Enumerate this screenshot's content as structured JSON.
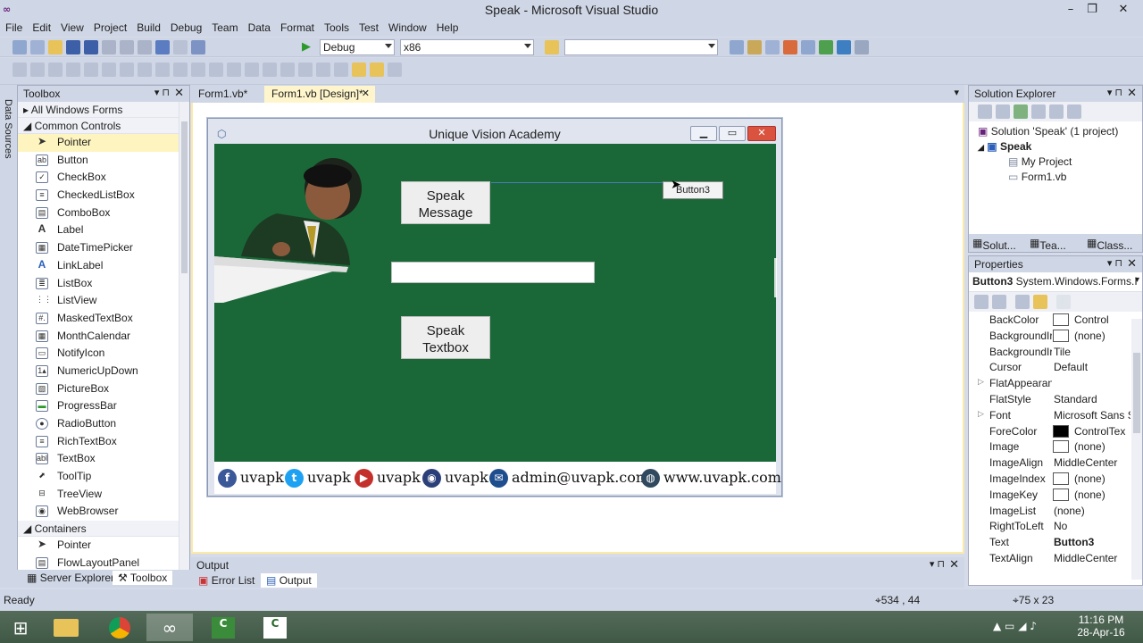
{
  "window": {
    "title": "Speak - Microsoft Visual Studio"
  },
  "menu": [
    "File",
    "Edit",
    "View",
    "Project",
    "Build",
    "Debug",
    "Team",
    "Data",
    "Format",
    "Tools",
    "Test",
    "Window",
    "Help"
  ],
  "toolbar": {
    "config": "Debug",
    "platform": "x86",
    "find": ""
  },
  "data_sources": {
    "label": "Data Sources"
  },
  "toolbox": {
    "title": "Toolbox",
    "group_all": "All Windows Forms",
    "group_common": "Common Controls",
    "items": [
      "Pointer",
      "Button",
      "CheckBox",
      "CheckedListBox",
      "ComboBox",
      "Label",
      "DateTimePicker",
      "LinkLabel",
      "ListBox",
      "ListView",
      "MaskedTextBox",
      "MonthCalendar",
      "NotifyIcon",
      "NumericUpDown",
      "PictureBox",
      "ProgressBar",
      "RadioButton",
      "RichTextBox",
      "TextBox",
      "ToolTip",
      "TreeView",
      "WebBrowser"
    ],
    "group_containers": "Containers",
    "container_items": [
      "Pointer",
      "FlowLayoutPanel"
    ]
  },
  "doc_tabs": {
    "tab1": "Form1.vb*",
    "tab2": "Form1.vb [Design]*"
  },
  "form": {
    "title": "Unique Vision Academy",
    "btn_speak_message": "Speak\nMessage",
    "btn_speak_message_l1": "Speak",
    "btn_speak_message_l2": "Message",
    "btn_speak_textbox_l1": "Speak",
    "btn_speak_textbox_l2": "Textbox",
    "button3": "Button3",
    "textbox_value": "",
    "footer": {
      "fb": "uvapk",
      "tw": "uvapk",
      "yt": "uvapk",
      "ig": "uvapk",
      "email": "admin@uvapk.com",
      "web": "www.uvapk.com"
    }
  },
  "solution_explorer": {
    "title": "Solution Explorer",
    "solution": "Solution 'Speak' (1 project)",
    "project": "Speak",
    "my_project": "My Project",
    "form_file": "Form1.vb",
    "tabs": [
      "Solut...",
      "Tea...",
      "Class..."
    ]
  },
  "properties": {
    "title": "Properties",
    "object": "Button3",
    "object_type": "System.Windows.Forms.I",
    "rows": [
      {
        "name": "BackColor",
        "value": "Control",
        "swatch": "white"
      },
      {
        "name": "BackgroundIr",
        "value": "(none)",
        "swatch": "white"
      },
      {
        "name": "BackgroundIr",
        "value": "Tile"
      },
      {
        "name": "Cursor",
        "value": "Default"
      },
      {
        "name": "FlatAppearan",
        "value": "",
        "expand": true
      },
      {
        "name": "FlatStyle",
        "value": "Standard"
      },
      {
        "name": "Font",
        "value": "Microsoft Sans S",
        "expand": true
      },
      {
        "name": "ForeColor",
        "value": "ControlTex",
        "swatch": "black"
      },
      {
        "name": "Image",
        "value": "(none)",
        "swatch": "white"
      },
      {
        "name": "ImageAlign",
        "value": "MiddleCenter"
      },
      {
        "name": "ImageIndex",
        "value": "(none)",
        "swatch": "white"
      },
      {
        "name": "ImageKey",
        "value": "(none)",
        "swatch": "white"
      },
      {
        "name": "ImageList",
        "value": "(none)"
      },
      {
        "name": "RightToLeft",
        "value": "No"
      },
      {
        "name": "Text",
        "value": "Button3",
        "bold": true
      },
      {
        "name": "TextAlign",
        "value": "MiddleCenter"
      }
    ]
  },
  "output": {
    "title": "Output",
    "tabs": [
      "Error List",
      "Output"
    ]
  },
  "bottom_tabs": [
    "Server Explorer",
    "Toolbox"
  ],
  "status": {
    "text": "Ready",
    "position": "534 , 44",
    "size": "75 x 23"
  },
  "taskbar": {
    "time": "11:16 PM",
    "date": "28-Apr-16"
  }
}
